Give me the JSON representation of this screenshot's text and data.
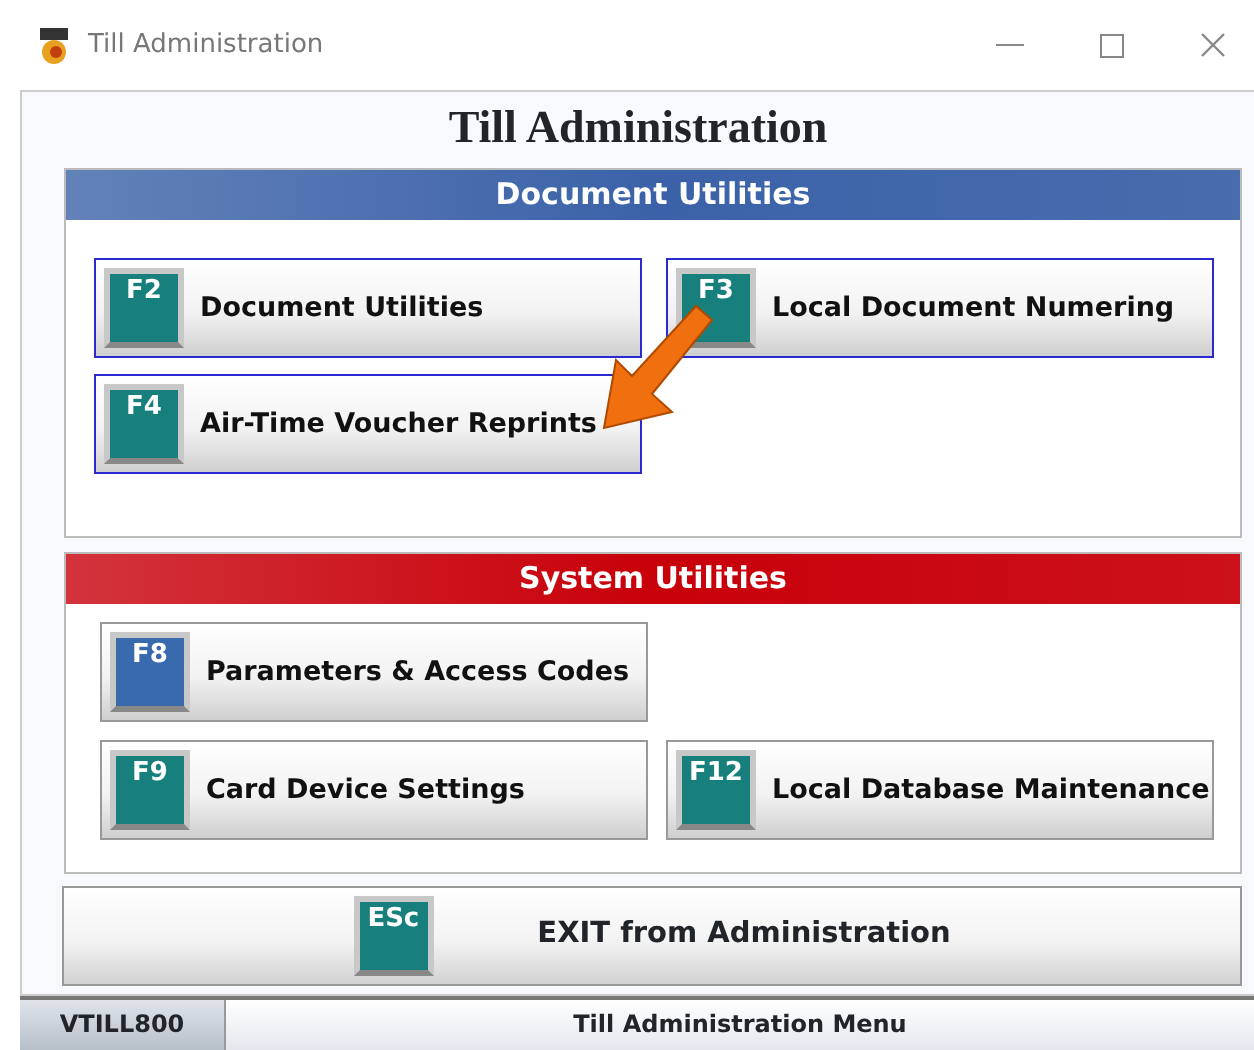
{
  "window": {
    "title": "Till Administration"
  },
  "heading": "Till Administration",
  "sections": [
    {
      "title": "Document Utilities",
      "color": "#3b62a8",
      "rows": [
        [
          {
            "key": "F2",
            "label": "Document Utilities",
            "highlighted": true,
            "color": "#17807c"
          },
          {
            "key": "F3",
            "label": "Local Document Numering",
            "highlighted": true,
            "color": "#17807c"
          }
        ],
        [
          {
            "key": "F4",
            "label": "Air-Time Voucher Reprints",
            "highlighted": true,
            "color": "#17807c"
          }
        ]
      ]
    },
    {
      "title": "System Utilities",
      "color": "#c8000a",
      "rows": [
        [
          {
            "key": "F8",
            "label": "Parameters & Access Codes",
            "highlighted": false,
            "color": "#3a6aae"
          }
        ],
        [
          {
            "key": "F9",
            "label": "Card Device Settings",
            "highlighted": false,
            "color": "#17807c"
          },
          {
            "key": "F12",
            "label": "Local Database Maintenance",
            "highlighted": false,
            "color": "#17807c"
          }
        ]
      ]
    }
  ],
  "exit_button": {
    "key": "ESc",
    "label": "EXIT from Administration",
    "color": "#17807c"
  },
  "status_bar": {
    "code": "VTILL800",
    "title": "Till Administration Menu"
  }
}
